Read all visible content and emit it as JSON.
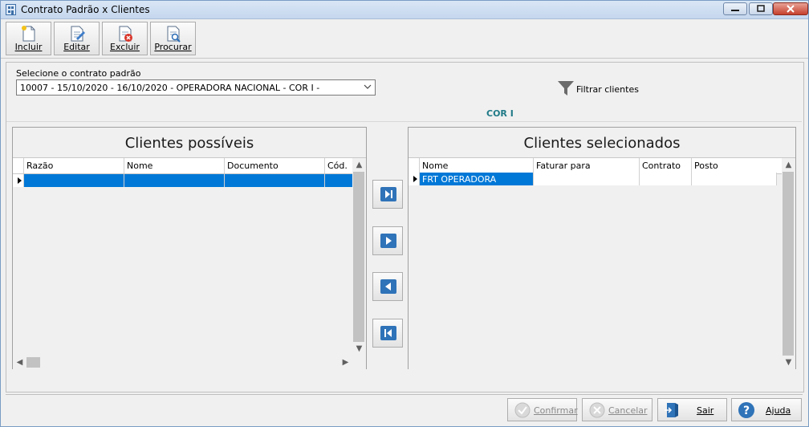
{
  "window": {
    "title": "Contrato Padrão x Clientes"
  },
  "toolbar": {
    "incluir": "Incluir",
    "editar": "Editar",
    "excluir": "Excluir",
    "procurar": "Procurar"
  },
  "contract": {
    "label": "Selecione o contrato padrão",
    "selected": "10007 - 15/10/2020 - 16/10/2020 - OPERADORA NACIONAL - COR I -"
  },
  "filter": {
    "label": "Filtrar clientes"
  },
  "cor_label": "COR I",
  "left_panel": {
    "title": "Clientes possíveis",
    "columns": [
      "Razão",
      "Nome",
      "Documento",
      "Cód."
    ],
    "rows": [
      [
        "",
        "",
        "",
        ""
      ]
    ]
  },
  "right_panel": {
    "title": "Clientes selecionados",
    "columns": [
      "Nome",
      "Faturar para",
      "Contrato",
      "Posto"
    ],
    "rows": [
      [
        "FRT OPERADORA",
        "",
        "",
        ""
      ]
    ]
  },
  "buttons": {
    "confirmar": "Confirmar",
    "cancelar": "Cancelar",
    "sair": "Sair",
    "ajuda": "Ajuda"
  },
  "colors": {
    "selection": "#0078d7",
    "accent_teal": "#207a87",
    "move_button_blue": "#2f73b8"
  },
  "icons": {
    "filter": "funnel-icon",
    "move_all_right": "move-all-right-icon",
    "move_right": "move-right-icon",
    "move_left": "move-left-icon",
    "move_all_left": "move-all-left-icon"
  }
}
